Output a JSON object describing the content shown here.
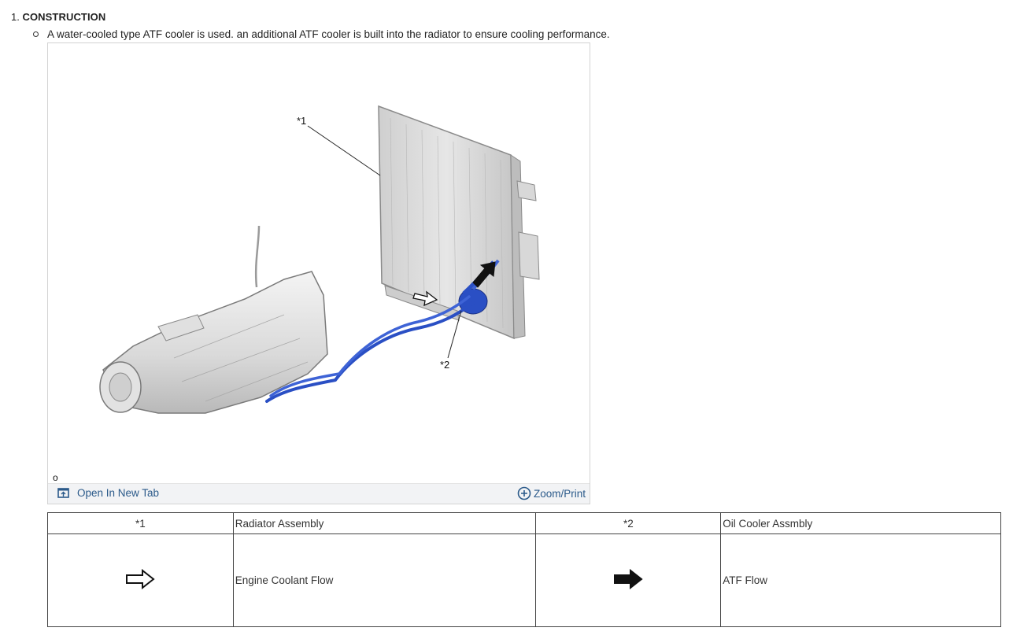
{
  "section": {
    "number": "1.",
    "title": "CONSTRUCTION"
  },
  "bullet_text": "A water-cooled type ATF cooler is used. an additional ATF cooler is built into the radiator to ensure cooling performance.",
  "figure": {
    "callouts": {
      "c1": "*1",
      "c2": "*2"
    },
    "figure_id": "o",
    "toolbar": {
      "open_new_tab": "Open In New Tab",
      "zoom_print": "Zoom/Print"
    },
    "icons": {
      "open": "open-in-new-tab-icon",
      "zoom": "zoom-plus-icon"
    },
    "colors": {
      "atf_line": "#2a4fc4",
      "toolbar_text": "#2b5a8a"
    }
  },
  "legend": {
    "row1": {
      "code1": "*1",
      "label1": "Radiator Assembly",
      "code2": "*2",
      "label2": "Oil Cooler Assmbly"
    },
    "row2": {
      "icon1": "outline-arrow-right-icon",
      "label1": "Engine Coolant Flow",
      "icon2": "solid-arrow-right-icon",
      "label2": "ATF Flow"
    }
  }
}
